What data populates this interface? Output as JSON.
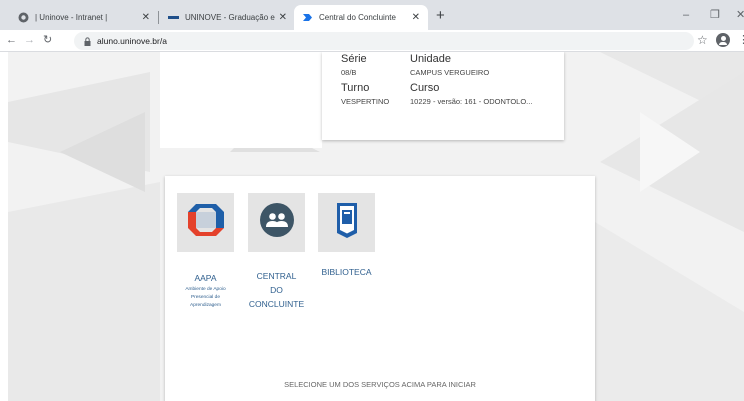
{
  "browser": {
    "tabs": [
      {
        "title": "| Uninove - Intranet |"
      },
      {
        "title": "UNINOVE - Graduação e Pós-gra"
      },
      {
        "title": "Central do Concluinte"
      }
    ],
    "url": "aluno.uninove.br/a"
  },
  "student_info": {
    "serie_label": "Série",
    "serie_value": "08/B",
    "unidade_label": "Unidade",
    "unidade_value": "CAMPUS VERGUEIRO",
    "turno_label": "Turno",
    "turno_value": "VESPERTINO",
    "curso_label": "Curso",
    "curso_value": "10229 - versão: 161 - ODONTOLO..."
  },
  "services": [
    {
      "name": "AAPA",
      "description": [
        "Ambiente de Apoio",
        "Presencial de",
        "Aprendizagem"
      ],
      "icon": "aapa-logo-icon"
    },
    {
      "name_lines": [
        "CENTRAL",
        "DO",
        "CONCLUINTE"
      ],
      "icon": "users-group-icon"
    },
    {
      "name": "BIBLIOTECA",
      "icon": "book-icon"
    }
  ],
  "footer_text": "SELECIONE UM DOS SERVIÇOS ACIMA PARA INICIAR",
  "colors": {
    "aapa_blue": "#1f5fa8",
    "aapa_red": "#e4412b",
    "concluinte_slate": "#3d5566",
    "biblioteca_blue": "#1f5ea9",
    "link_text": "#2f5f8e"
  }
}
